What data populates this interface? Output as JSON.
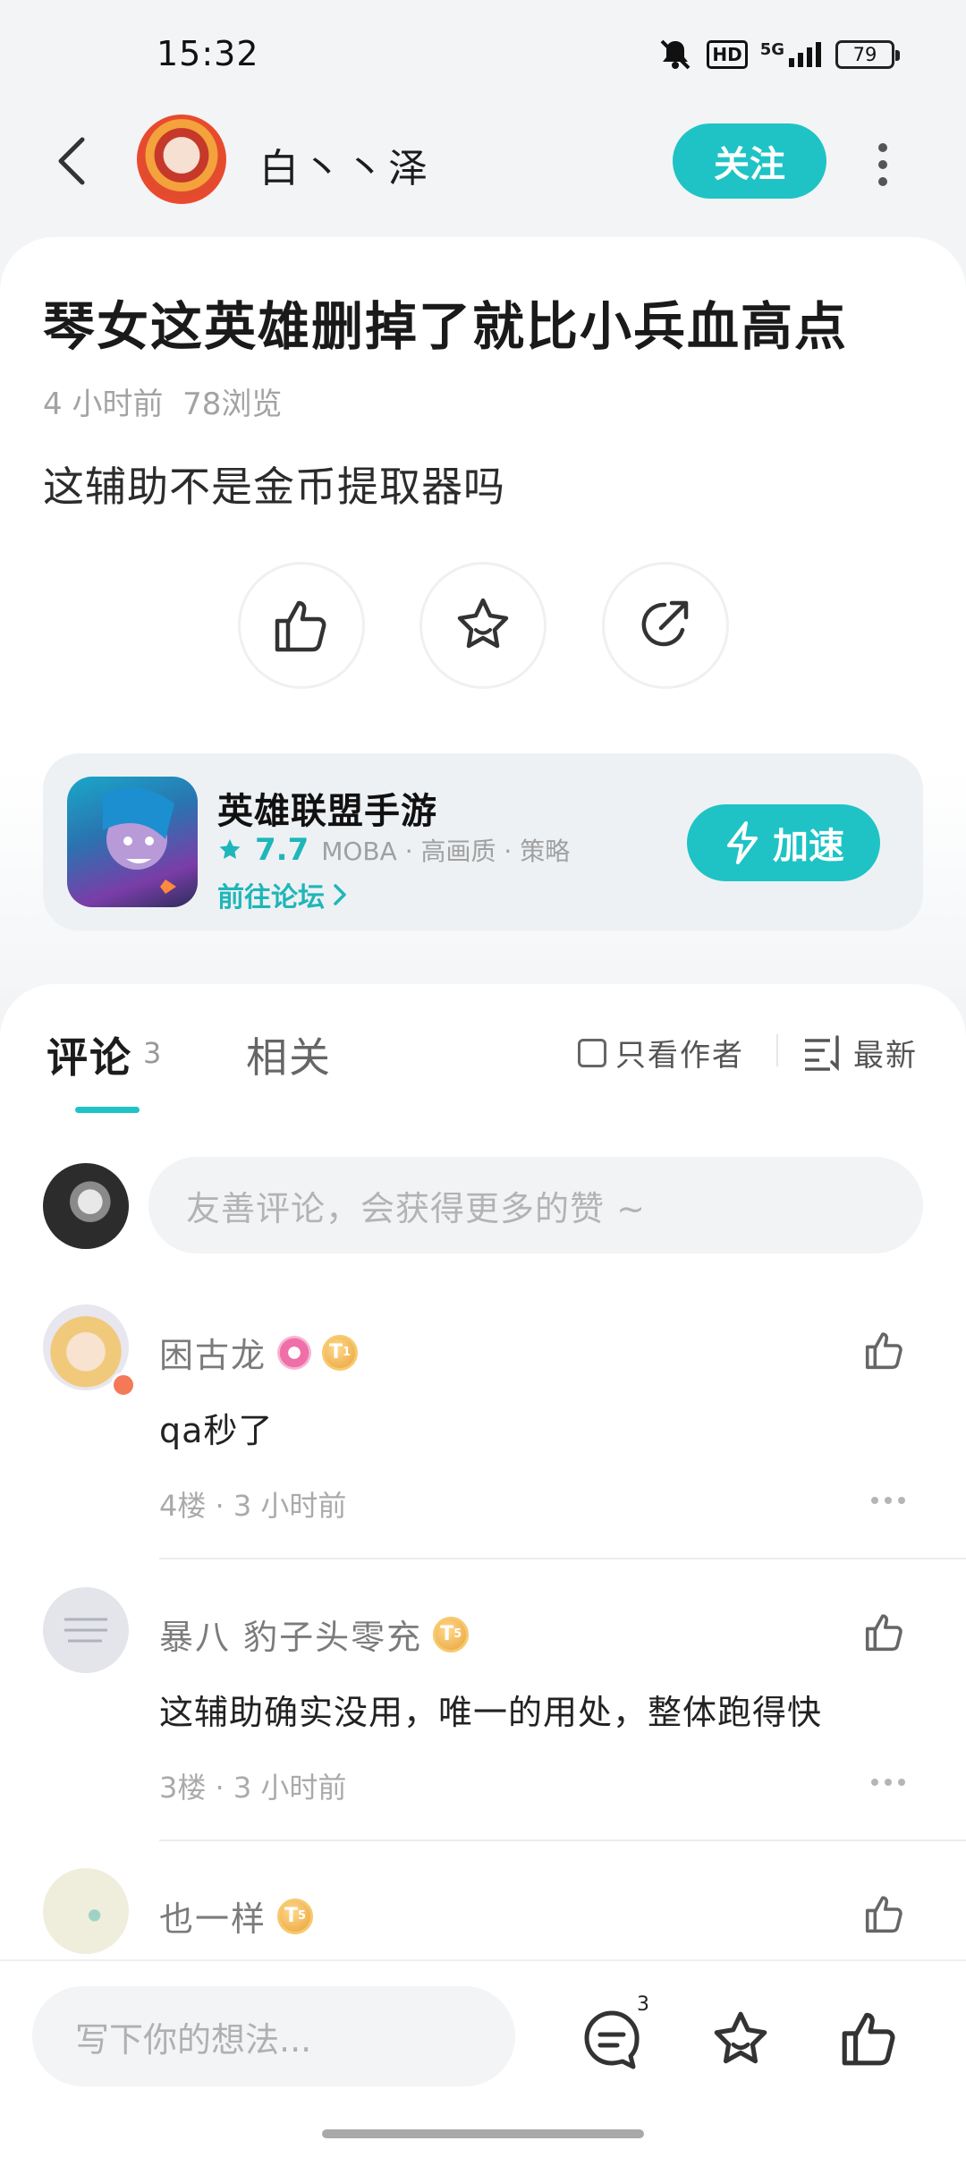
{
  "status_bar": {
    "time": "15:32",
    "hd": "HD",
    "network": "5G",
    "battery": "79"
  },
  "header": {
    "author_name": "白丶丶泽",
    "follow_label": "关注"
  },
  "post": {
    "title": "琴女这英雄删掉了就比小兵血高点",
    "time_ago": "4 小时前",
    "views": "78浏览",
    "body": "这辅助不是金币提取器吗"
  },
  "game": {
    "name": "英雄联盟手游",
    "rating": "7.7",
    "tags": "MOBA · 高画质 · 策略",
    "forum_link": "前往论坛",
    "speed_label": "加速"
  },
  "comments_section": {
    "tab_comments": "评论",
    "comment_count": "3",
    "tab_related": "相关",
    "author_only": "只看作者",
    "sort_label": "最新",
    "input_placeholder": "友善评论，会获得更多的赞 ~"
  },
  "comments": [
    {
      "name": "困古龙",
      "text": "qa秒了",
      "meta": "4楼 · 3 小时前",
      "badge_level": "1"
    },
    {
      "name": "暴八 豹子头零充",
      "text": "这辅助确实没用，唯一的用处，整体跑得快",
      "meta": "3楼 · 3 小时前",
      "badge_level": "5"
    },
    {
      "name": "也一样",
      "text": "",
      "meta": "",
      "badge_level": "5"
    }
  ],
  "bottom_bar": {
    "placeholder": "写下你的想法...",
    "comment_badge": "3"
  },
  "colors": {
    "accent": "#1fc3c5",
    "accent_text": "#1fb6b9",
    "muted": "#a3a3a3"
  }
}
